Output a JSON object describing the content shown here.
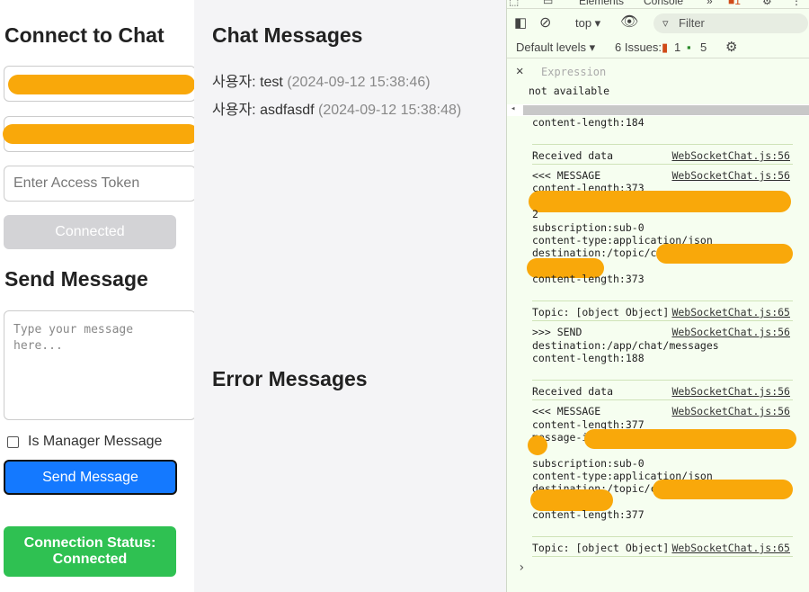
{
  "left": {
    "connect_title": "Connect to Chat",
    "token_placeholder": "Enter Access Token",
    "connect_button": "Connected",
    "send_title": "Send Message",
    "message_placeholder": "Type your message here...",
    "manager_label": "Is Manager Message",
    "send_button": "Send Message",
    "status_line1": "Connection Status:",
    "status_line2": "Connected"
  },
  "middle": {
    "chat_title": "Chat Messages",
    "messages": [
      {
        "sender": "사용자",
        "text": ": test",
        "time": "(2024-09-12 15:38:46)"
      },
      {
        "sender": "사용자",
        "text": ": asdfasdf",
        "time": "(2024-09-12 15:38:48)"
      }
    ],
    "error_title": "Error Messages"
  },
  "devtools": {
    "tabs": [
      "Elements",
      "Console"
    ],
    "context": "top ▾",
    "filter_placeholder": "Filter",
    "default_levels": "Default levels ▾",
    "issues_label": "6 Issues:",
    "issues_error_count": "1",
    "issues_msg_count": "5",
    "expression_placeholder": "Expression",
    "expression_value": "not available",
    "console": {
      "line_content_length_184": "content-length:184",
      "received_1": "Received data",
      "src_56": "WebSocketChat.js:56",
      "msg_1": "<<< MESSAGE",
      "len_373": "content-length:373",
      "frag_2": "2",
      "subscription": "subscription:sub-0",
      "content_type": "content-type:application/json",
      "destination_1": "destination:/topic/chat",
      "len_373b": "content-length:373",
      "topic": "Topic: [object Object]",
      "src_65": "WebSocketChat.js:65",
      "send": ">>> SEND",
      "destination_send": "destination:/app/chat/messages",
      "len_188": "content-length:188",
      "received_2": "Received data",
      "msg_2": "<<< MESSAGE",
      "len_377": "content-length:377",
      "message_id": "message-id",
      "subscription_2": "subscription:sub-0",
      "content_type_2": "content-type:application/json",
      "destination_2": "destination:/topic/chat",
      "len_377b": "content-length:377",
      "topic_2": "Topic: [object Object]",
      "prompt": "›"
    }
  }
}
